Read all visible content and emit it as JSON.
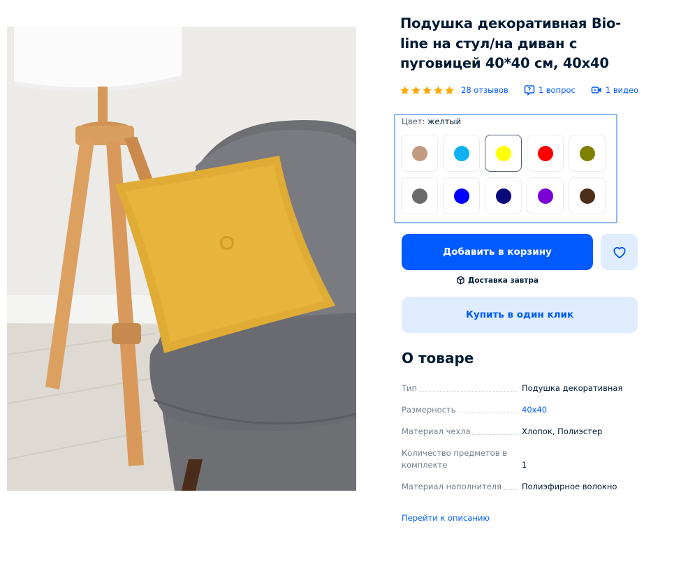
{
  "product": {
    "title": "Подушка декоративная Bio-line на стул/на диван с пуговицей 40*40 см, 40х40",
    "rating": 5,
    "reviews": "28 отзывов",
    "questions": "1 вопрос",
    "videos": "1 видео"
  },
  "color_selector": {
    "label": "Цвет:",
    "selected": "желтый",
    "swatches": [
      {
        "color": "#c19a80"
      },
      {
        "color": "#10b1f0"
      },
      {
        "color": "#ffff00",
        "selected": true
      },
      {
        "color": "#ff0000"
      },
      {
        "color": "#808000"
      },
      {
        "color": "#6b6b6b"
      },
      {
        "color": "#0000ff"
      },
      {
        "color": "#0a0a7a"
      },
      {
        "color": "#7a00d6"
      },
      {
        "color": "#4b2e17"
      }
    ]
  },
  "actions": {
    "add_to_cart": "Добавить в корзину",
    "favorite_icon": "heart-icon",
    "delivery": "Доставка завтра",
    "buy_one_click": "Купить в один клик"
  },
  "about": {
    "heading": "О товаре",
    "specs": [
      {
        "key": "Тип",
        "value": "Подушка декоративная"
      },
      {
        "key": "Размерность",
        "value": "40х40",
        "link": true
      },
      {
        "key": "Материал чехла",
        "value": "Хлопок, Полиэстер"
      },
      {
        "key": "Количество предметов в комплекте",
        "value": "1"
      },
      {
        "key": "Материал наполнителя",
        "value": "Полиэфирное волокно"
      }
    ],
    "goto_description": "Перейти к описанию"
  },
  "colors": {
    "accent": "#005bff",
    "accent_light": "#e0edff",
    "star": "#ffa800",
    "text": "#001a34"
  }
}
